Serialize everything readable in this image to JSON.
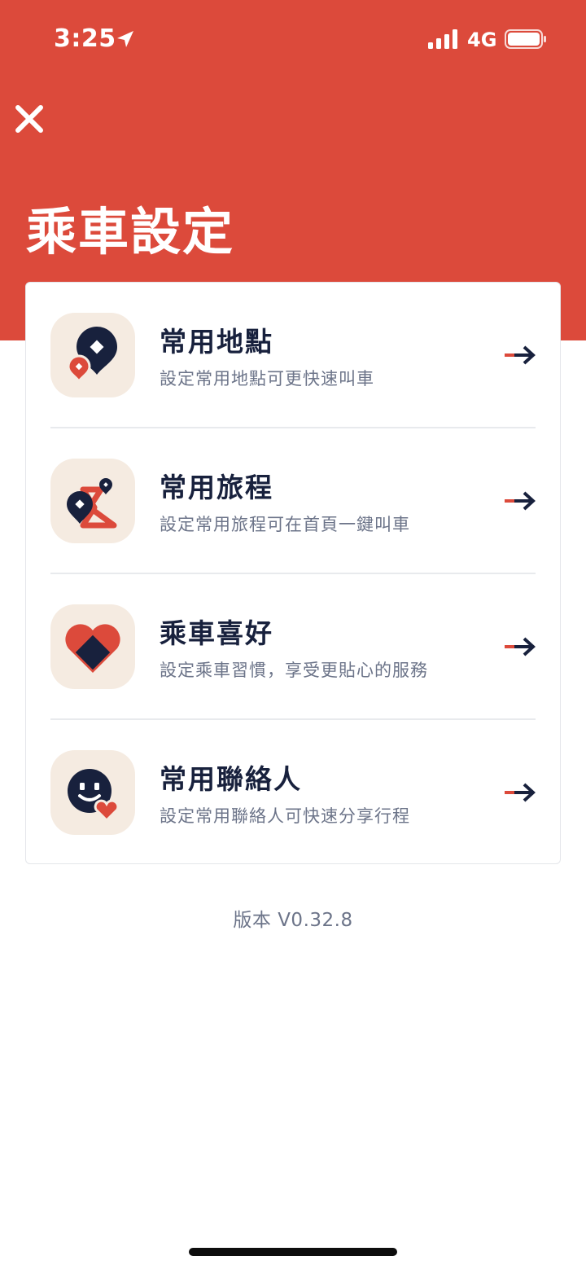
{
  "status_bar": {
    "time": "3:25",
    "network": "4G",
    "icons": [
      "location-arrow-icon",
      "signal-bars-icon",
      "battery-icon"
    ]
  },
  "header": {
    "close_icon": "close-icon",
    "title": "乘車設定"
  },
  "settings_items": [
    {
      "title": "常用地點",
      "subtitle": "設定常用地點可更快速叫車",
      "icon": "favorite-places-icon"
    },
    {
      "title": "常用旅程",
      "subtitle": "設定常用旅程可在首頁一鍵叫車",
      "icon": "favorite-trips-icon"
    },
    {
      "title": "乘車喜好",
      "subtitle": "設定乘車習慣，享受更貼心的服務",
      "icon": "ride-preferences-icon"
    },
    {
      "title": "常用聯絡人",
      "subtitle": "設定常用聯絡人可快速分享行程",
      "icon": "favorite-contacts-icon"
    }
  ],
  "version": "版本 V0.32.8",
  "colors": {
    "brand_red": "#dc4a3b",
    "navy": "#18213d",
    "icon_tile": "#f5ebe1",
    "subtitle_gray": "#6c7489"
  }
}
